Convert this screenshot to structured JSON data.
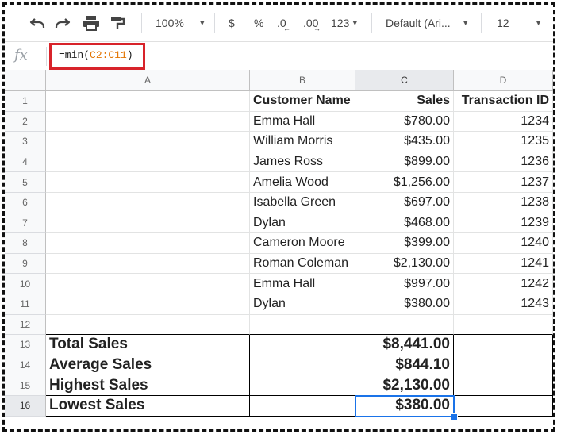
{
  "toolbar": {
    "zoom": "100%",
    "currency": "$",
    "percent": "%",
    "dec_decrease": ".0",
    "dec_increase": ".00",
    "more_formats": "123",
    "font_family": "Default (Ari...",
    "font_size": "12"
  },
  "formula_bar": {
    "fx_label": "fx",
    "prefix": "=min(",
    "range": "C2:C11",
    "suffix": ")"
  },
  "columns": [
    "A",
    "B",
    "C",
    "D"
  ],
  "rows": [
    {
      "num": "1",
      "a": "",
      "b": "Customer Name",
      "c": "Sales",
      "d": "Transaction ID"
    },
    {
      "num": "2",
      "a": "",
      "b": "Emma Hall",
      "c": "$780.00",
      "d": "1234"
    },
    {
      "num": "3",
      "a": "",
      "b": "William Morris",
      "c": "$435.00",
      "d": "1235"
    },
    {
      "num": "4",
      "a": "",
      "b": "James Ross",
      "c": "$899.00",
      "d": "1236"
    },
    {
      "num": "5",
      "a": "",
      "b": "Amelia Wood",
      "c": "$1,256.00",
      "d": "1237"
    },
    {
      "num": "6",
      "a": "",
      "b": "Isabella Green",
      "c": "$697.00",
      "d": "1238"
    },
    {
      "num": "7",
      "a": "",
      "b": "Dylan",
      "c": "$468.00",
      "d": "1239"
    },
    {
      "num": "8",
      "a": "",
      "b": "Cameron Moore",
      "c": "$399.00",
      "d": "1240"
    },
    {
      "num": "9",
      "a": "",
      "b": "Roman Coleman",
      "c": "$2,130.00",
      "d": "1241"
    },
    {
      "num": "10",
      "a": "",
      "b": "Emma Hall",
      "c": "$997.00",
      "d": "1242"
    },
    {
      "num": "11",
      "a": "",
      "b": "Dylan",
      "c": "$380.00",
      "d": "1243"
    },
    {
      "num": "12",
      "a": "",
      "b": "",
      "c": "",
      "d": ""
    },
    {
      "num": "13",
      "a": "Total Sales",
      "b": "",
      "c": "$8,441.00",
      "d": ""
    },
    {
      "num": "14",
      "a": "Average Sales",
      "b": "",
      "c": "$844.10",
      "d": ""
    },
    {
      "num": "15",
      "a": "Highest Sales",
      "b": "",
      "c": "$2,130.00",
      "d": ""
    },
    {
      "num": "16",
      "a": "Lowest Sales",
      "b": "",
      "c": "$380.00",
      "d": ""
    }
  ],
  "selected_cell": "C16",
  "colors": {
    "highlight_box": "#d8232a",
    "selection": "#1a73e8",
    "range_text": "#e37400"
  }
}
